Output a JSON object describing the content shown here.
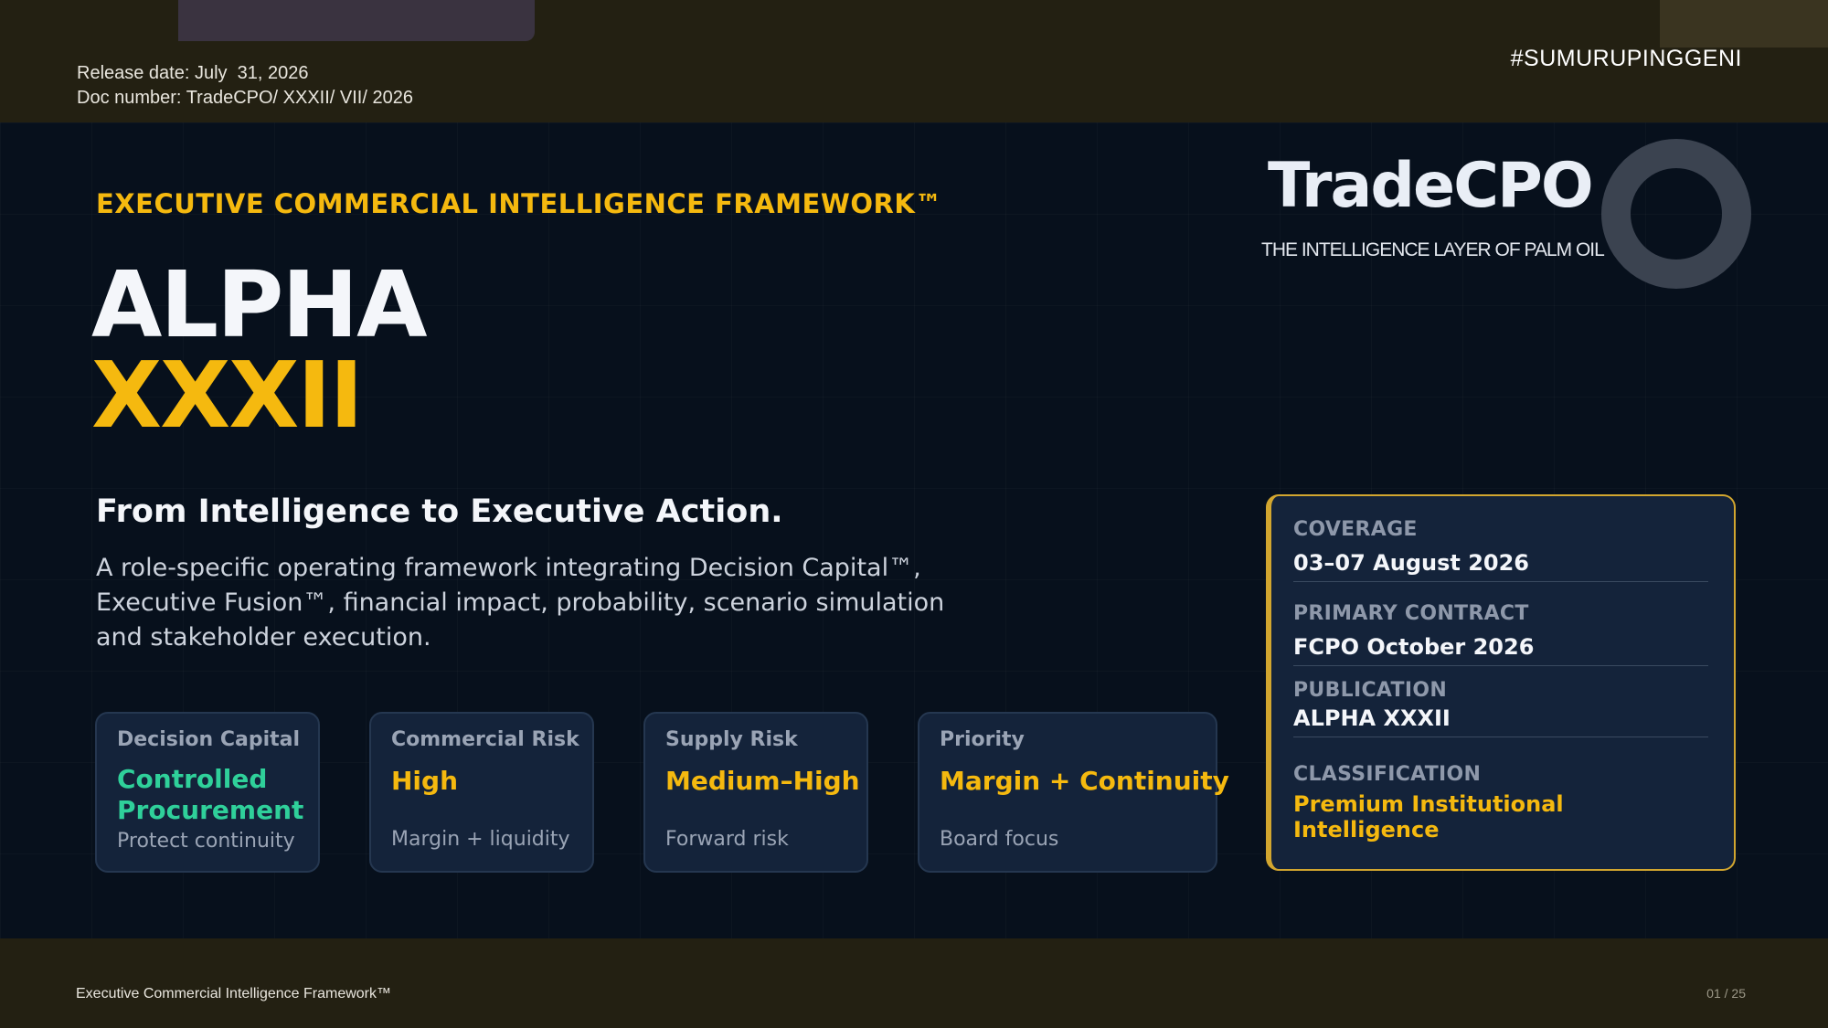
{
  "header": {
    "release_date": "Release date: July  31, 2026",
    "doc_number": "Doc number: TradeCPO/ XXXII/ VII/ 2026",
    "hashtag": "#SUMURUPINGGENI"
  },
  "hero": {
    "eyebrow": "EXECUTIVE COMMERCIAL INTELLIGENCE FRAMEWORK™",
    "title": "ALPHA",
    "subtitle": "XXXII",
    "tagline": "From Intelligence to Executive Action.",
    "description": "A role-specific operating framework integrating Decision Capital™, Executive Fusion™, financial impact, probability, scenario simulation and stakeholder execution."
  },
  "logo": {
    "wordmark": "TradeCPO",
    "tagline": "THE INTELLIGENCE LAYER OF PALM OIL"
  },
  "metrics": [
    {
      "label": "Decision Capital",
      "value": "Controlled\nProcurement",
      "note": "Protect continuity",
      "value_color": "#2fd09a"
    },
    {
      "label": "Commercial Risk",
      "value": "High",
      "note": "Margin + liquidity",
      "value_color": "#f5b90f"
    },
    {
      "label": "Supply Risk",
      "value": "Medium–High",
      "note": "Forward risk",
      "value_color": "#f5b90f"
    },
    {
      "label": "Priority",
      "value": "Margin + Continuity",
      "note": "Board focus",
      "value_color": "#f5b90f"
    }
  ],
  "info": {
    "coverage_label": "COVERAGE",
    "coverage_value": "03–07 August 2026",
    "contract_label": "PRIMARY CONTRACT",
    "contract_value": "FCPO October 2026",
    "publication_label": "PUBLICATION",
    "publication_value": "ALPHA XXXII",
    "classification_label": "CLASSIFICATION",
    "classification_value": "Premium Institutional Intelligence"
  },
  "footer": {
    "title": "Executive Commercial Intelligence Framework™",
    "page": "01 / 25"
  },
  "colors": {
    "accent": "#f5b90f",
    "green": "#2fd09a",
    "background": "#07101c",
    "band": "#232012"
  },
  "icons": {
    "logo_mark": "ring-icon"
  }
}
